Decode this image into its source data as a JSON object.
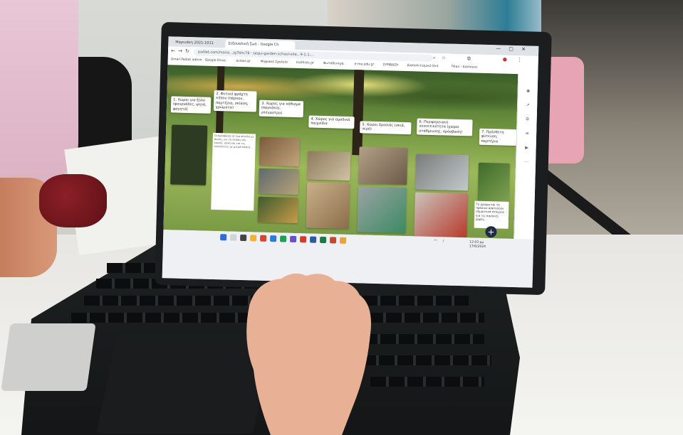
{
  "browser": {
    "tabs": [
      {
        "label": "Μαρινάκη 2021-1011"
      },
      {
        "label": "Σεξουαλική ζωή - Google Ch"
      }
    ],
    "url": "padlet.com/maria.../g7bhc78 · sequi-garden-school-site...9-1-1-...",
    "bookmarks": [
      "Gmail Padlet admin",
      "Google Drive",
      "eclass.gr",
      "Ψηφιακό Σχολείο",
      "mathisis.gr",
      "Φωτόδεντρα",
      "e-me.edu.gr",
      "ΣΥΜΒΑΣΗ",
      "Διαπολιτισμικό Εκπ.",
      "Πλαν - Διάλογος"
    ],
    "window_controls": [
      "—",
      "▢",
      "✕"
    ]
  },
  "board": {
    "notes": [
      "1. Χώροι για ξύλο (φουρνάδες, ψητά, φαγητό)",
      "2. Φυτικό φράχτη κήπου (πάρκου, παρτέρια, σκίαση, χρώματα)",
      "3. Χώρος για κάθισμα (παγκάκια, στέγαστρο)",
      "4. Χώρος για ομαδικά παιχνίδια",
      "5. Χώροι δροσιάς (σκιά, νερό)",
      "6. Περιφερειακή συνεκτικότητα (χώροι στάθμευσης, πρόσβαση)",
      "7. Πρόσθετη φύτευση, παρτέρια"
    ],
    "text_card": "Οι πρόσβαση σε ένα σύνολο με άνεση, για τη στάση του κοινού, αλλά και για τις οικογένειες με μικρά παιδιά..."
  },
  "side_note": "Το χρώμα και το πράσινο αποτελούν σημαντικά στοιχεία για τις παιδικές χαρές...",
  "taskbar": {
    "clock": "12:03 μμ",
    "date": "17/6/2024"
  },
  "colors": {
    "teal_frame": "#3a8f8a",
    "board_green": "#6a8f3c",
    "fab": "#1f2a44"
  },
  "icons": [
    "search-icon",
    "star-icon",
    "extensions-icon",
    "plus-icon",
    "windows-start-icon",
    "wifi-icon",
    "volume-icon"
  ]
}
